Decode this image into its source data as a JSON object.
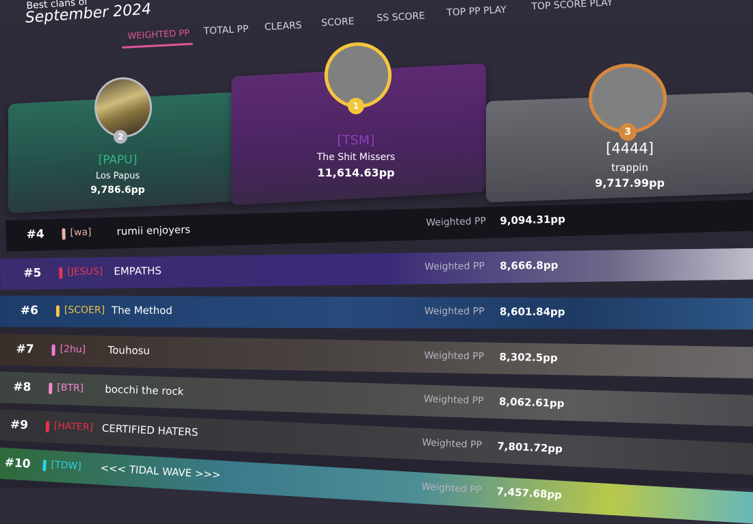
{
  "header": {
    "subtitle": "Best clans of",
    "title": "September 2024"
  },
  "tabs": [
    {
      "label": "WEIGHTED PP",
      "active": true
    },
    {
      "label": "TOTAL PP",
      "active": false
    },
    {
      "label": "CLEARS",
      "active": false
    },
    {
      "label": "SCORE",
      "active": false
    },
    {
      "label": "SS SCORE",
      "active": false
    },
    {
      "label": "TOP PP PLAY",
      "active": false
    },
    {
      "label": "TOP SCORE PLAY",
      "active": false
    }
  ],
  "podium": [
    {
      "rank": "2",
      "tag": "[PAPU]",
      "name": "Los Papus",
      "pp": "9,786.6pp",
      "tag_color": "#35b58c"
    },
    {
      "rank": "1",
      "tag": "[TSM]",
      "name": "The Shit Missers",
      "pp": "11,614.63pp",
      "tag_color": "#8d3fbd"
    },
    {
      "rank": "3",
      "tag": "[4444]",
      "name": "trappin",
      "pp": "9,717.99pp",
      "tag_color": "#ffffff"
    }
  ],
  "rows": [
    {
      "rank": "#4",
      "tag": "[wa]",
      "name": "rumii enjoyers",
      "metric": "Weighted PP",
      "pp": "9,094.31pp",
      "tag_color": "#e8b3a8"
    },
    {
      "rank": "#5",
      "tag": "[JESUS]",
      "name": "EMPATHS",
      "metric": "Weighted PP",
      "pp": "8,666.8pp",
      "tag_color": "#e23a52"
    },
    {
      "rank": "#6",
      "tag": "[SCOER]",
      "name": "The Method",
      "metric": "Weighted PP",
      "pp": "8,601.84pp",
      "tag_color": "#f3c54a"
    },
    {
      "rank": "#7",
      "tag": "[2hu]",
      "name": "Touhosu",
      "metric": "Weighted PP",
      "pp": "8,302.5pp",
      "tag_color": "#f07ad6"
    },
    {
      "rank": "#8",
      "tag": "[BTR]",
      "name": "bocchi the rock",
      "metric": "Weighted PP",
      "pp": "8,062.61pp",
      "tag_color": "#f58ad0"
    },
    {
      "rank": "#9",
      "tag": "[HATER]",
      "name": "CERTIFIED HATERS",
      "metric": "Weighted PP",
      "pp": "7,801.72pp",
      "tag_color": "#e8324a"
    },
    {
      "rank": "#10",
      "tag": "[TDW]",
      "name": "<<< TIDAL WAVE >>>",
      "metric": "Weighted PP",
      "pp": "7,457.68pp",
      "tag_color": "#2fd0e0"
    }
  ]
}
